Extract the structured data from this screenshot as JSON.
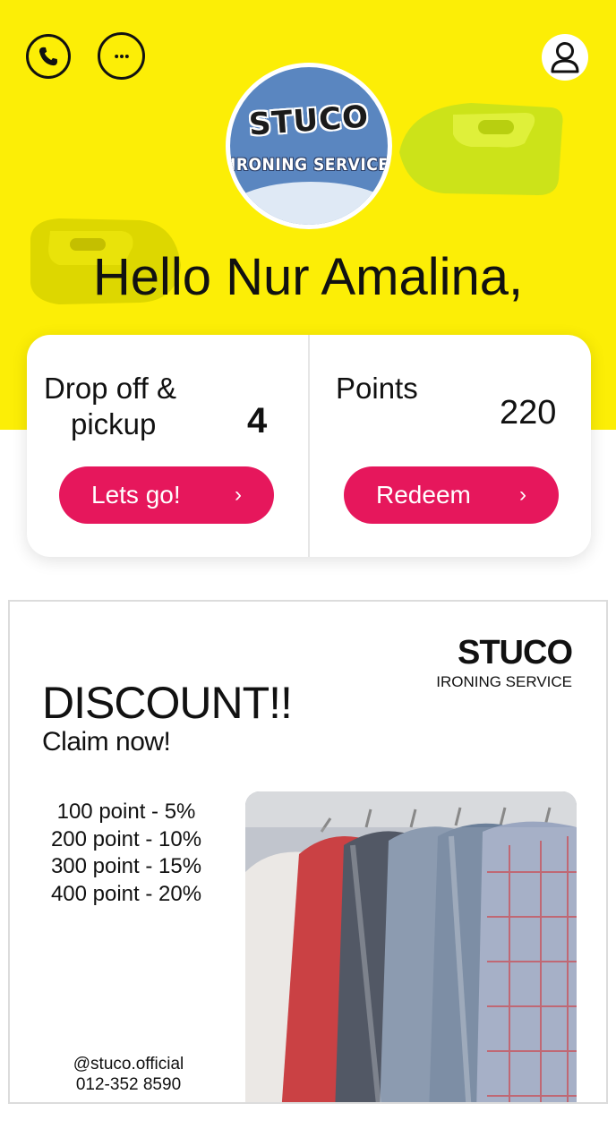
{
  "header": {
    "logo_title": "STUCO",
    "logo_subtitle": "IRONING SERVICE",
    "greeting": "Hello Nur Amalina,",
    "icons": [
      "phone-icon",
      "chat-icon",
      "profile-icon"
    ]
  },
  "summary": {
    "dropoff": {
      "label_line1": "Drop off &",
      "label_line2": "pickup",
      "value": "4",
      "button_label": "Lets go!",
      "button_chevron": "›"
    },
    "points": {
      "label": "Points",
      "value": "220",
      "button_label": "Redeem",
      "button_chevron": "›"
    }
  },
  "promo": {
    "brand_title": "STUCO",
    "brand_subtitle": "IRONING SERVICE",
    "headline": "DISCOUNT!!",
    "subheadline": "Claim now!",
    "tiers": [
      "100 point - 5%",
      "200 point - 10%",
      "300 point - 15%",
      "400 point - 20%"
    ],
    "social": "@stuco.official",
    "phone": "012-352 8590"
  },
  "colors": {
    "hero_bg": "#fcee06",
    "accent": "#e6175c",
    "logo_blue": "#5a86c0",
    "iron_green": "#c9e11a"
  }
}
